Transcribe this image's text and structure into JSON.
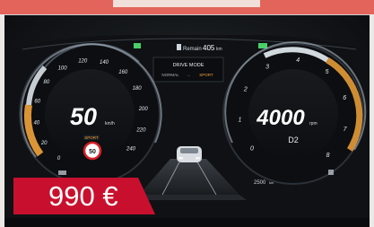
{
  "header": {
    "title_fragment": ""
  },
  "cluster": {
    "trip_label": "Remain",
    "trip_value": "405",
    "trip_unit": "km",
    "drive_mode_title": "DRIVE MODE",
    "drive_mode_from": "NORMAL",
    "drive_mode_arrow": "→",
    "drive_mode_to": "SPORT",
    "speed_value": "50",
    "speed_unit": "km/h",
    "speed_ticks": [
      "0",
      "20",
      "40",
      "60",
      "80",
      "100",
      "120",
      "140",
      "160",
      "180",
      "200",
      "220",
      "240"
    ],
    "rpm_value": "4000",
    "rpm_unit": "rpm",
    "rpm_ticks": [
      "0",
      "1",
      "2",
      "3",
      "4",
      "5",
      "6",
      "7",
      "8"
    ],
    "gear": "D2",
    "odometer": "2500",
    "odometer_unit": "km",
    "sport_badge": "SPORT",
    "speed_limit": "50",
    "accent_color": "#f2a33a",
    "sign_color": "#d91f26"
  },
  "price_tag": {
    "label": "990 €",
    "color": "#c8102e"
  }
}
